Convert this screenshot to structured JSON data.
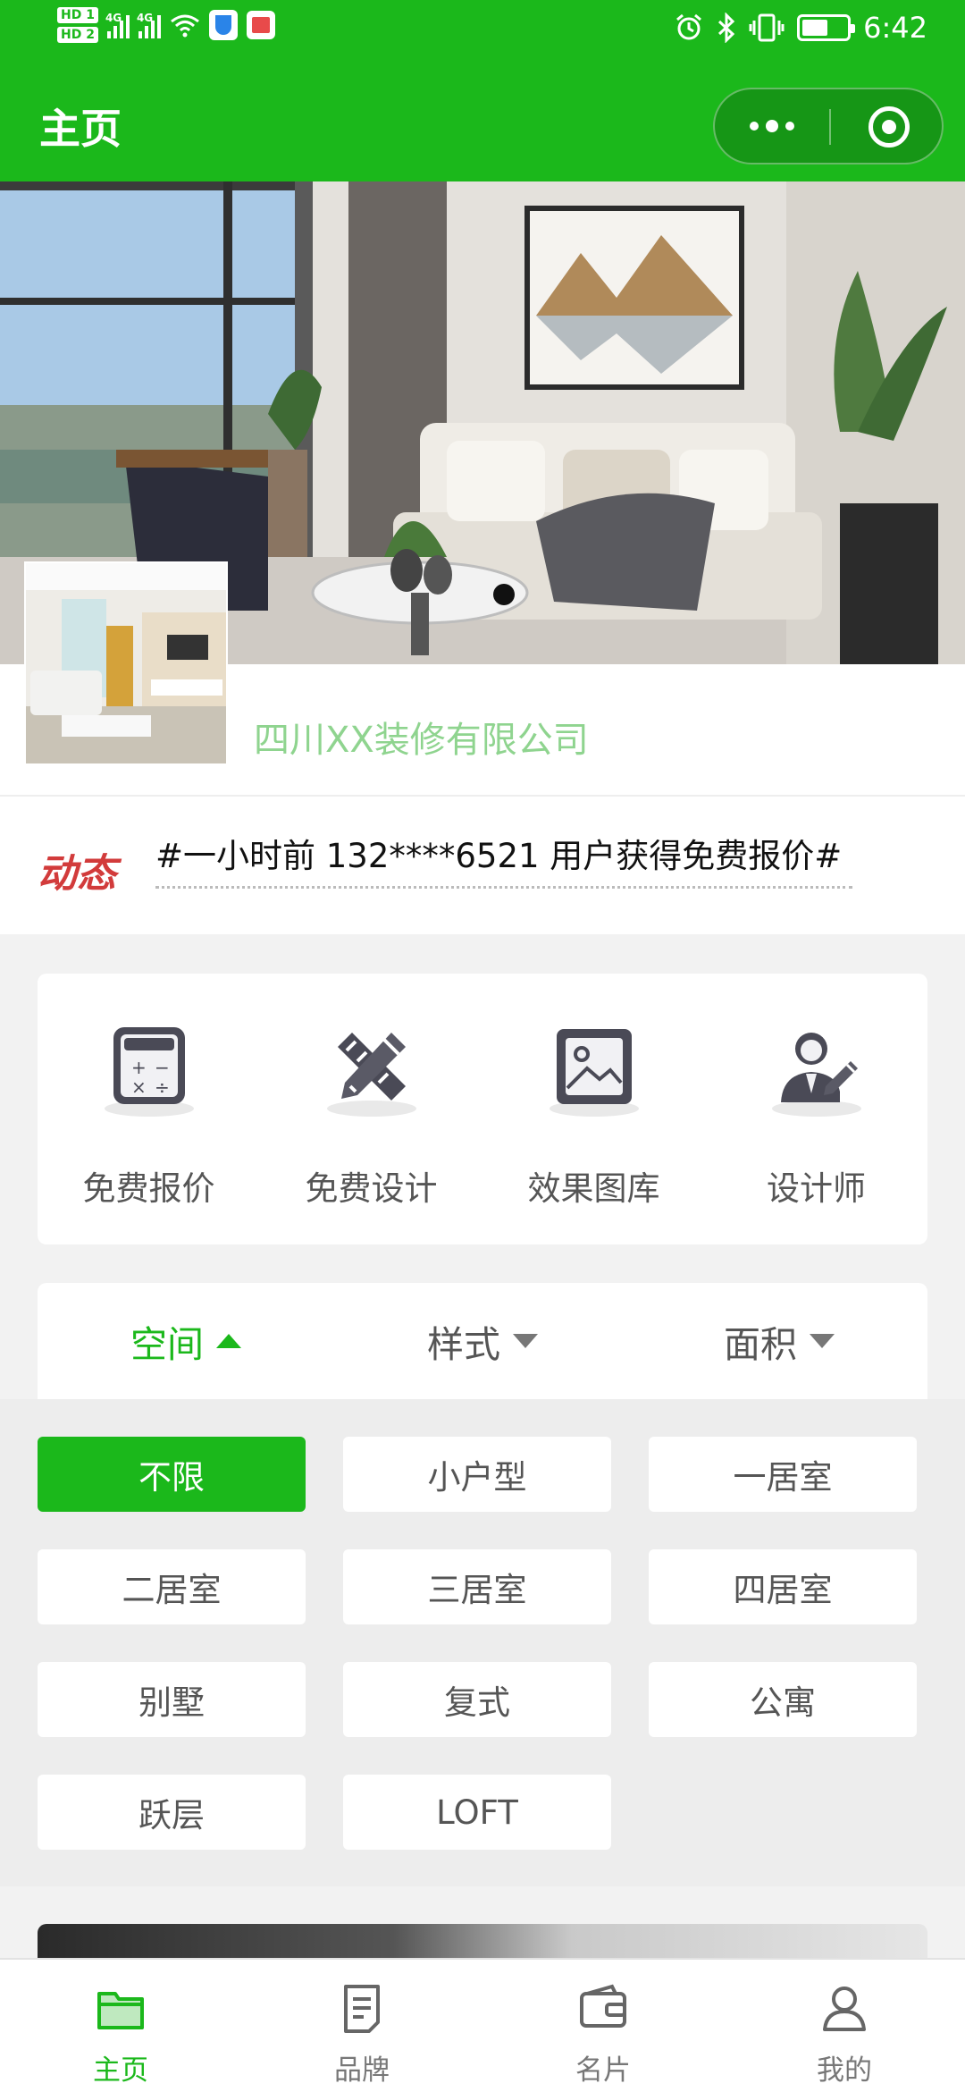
{
  "status_bar": {
    "time": "6:42",
    "sim1": "HD 1",
    "sim2": "HD 2",
    "network": "4G"
  },
  "nav": {
    "title": "主页"
  },
  "company": {
    "name": "四川XX装修有限公司"
  },
  "news": {
    "tag": "动态",
    "text": "#一小时前 132****6521 用户获得免费报价#"
  },
  "quick_actions": [
    {
      "label": "免费报价",
      "icon": "calculator-icon"
    },
    {
      "label": "免费设计",
      "icon": "ruler-pencil-icon"
    },
    {
      "label": "效果图库",
      "icon": "image-gallery-icon"
    },
    {
      "label": "设计师",
      "icon": "designer-icon"
    }
  ],
  "filter_tabs": [
    {
      "label": "空间",
      "active": true
    },
    {
      "label": "样式",
      "active": false
    },
    {
      "label": "面积",
      "active": false
    }
  ],
  "space_options": [
    {
      "label": "不限",
      "selected": true
    },
    {
      "label": "小户型"
    },
    {
      "label": "一居室"
    },
    {
      "label": "二居室"
    },
    {
      "label": "三居室"
    },
    {
      "label": "四居室"
    },
    {
      "label": "别墅"
    },
    {
      "label": "复式"
    },
    {
      "label": "公寓"
    },
    {
      "label": "跃层"
    },
    {
      "label": "LOFT"
    }
  ],
  "tabbar": [
    {
      "label": "主页",
      "icon": "folder-icon",
      "active": true
    },
    {
      "label": "品牌",
      "icon": "document-icon"
    },
    {
      "label": "名片",
      "icon": "wallet-icon"
    },
    {
      "label": "我的",
      "icon": "user-icon"
    }
  ],
  "colors": {
    "accent": "#1bb81b",
    "news_tag": "#d23b3b",
    "company_name": "#8fd48f"
  }
}
